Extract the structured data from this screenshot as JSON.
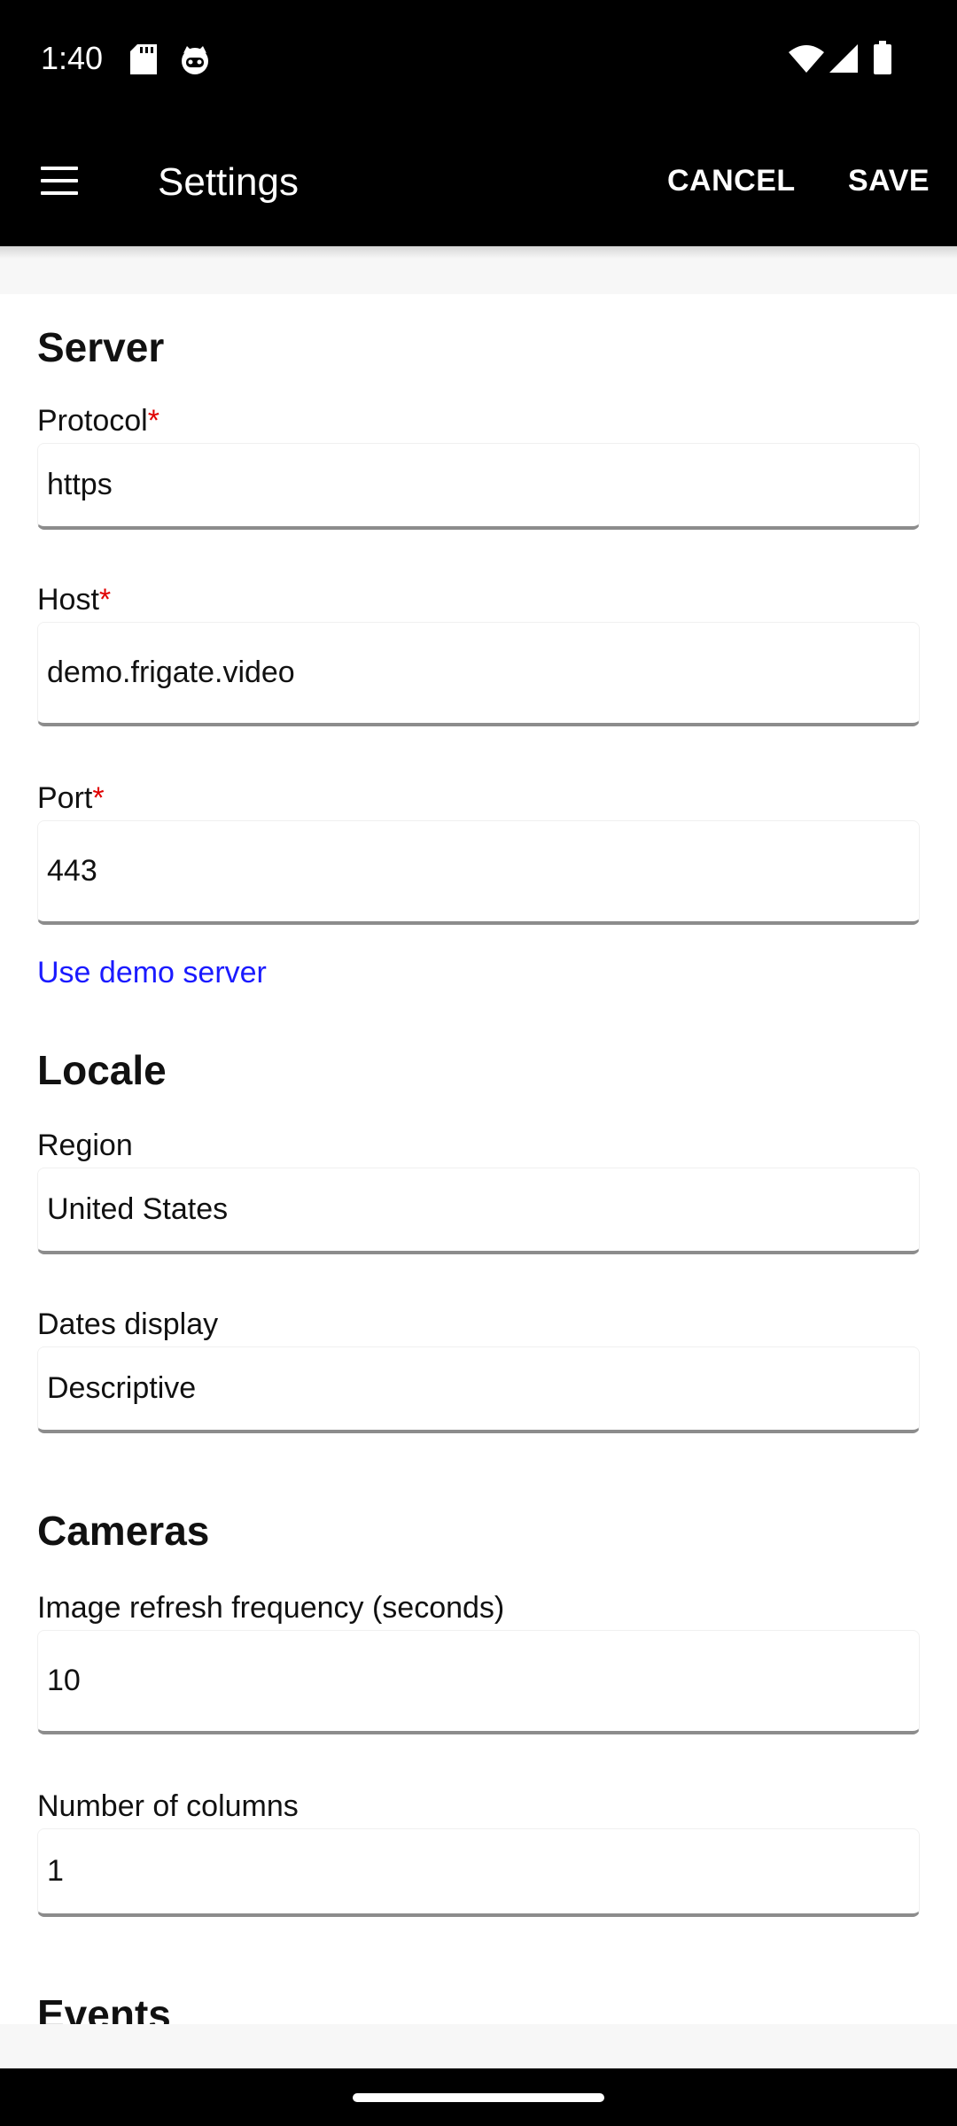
{
  "status_bar": {
    "time": "1:40",
    "icons": [
      "sd-card-icon",
      "cat-face-icon",
      "wifi-icon",
      "cell-signal-icon",
      "battery-icon"
    ]
  },
  "app_bar": {
    "menu_icon": "hamburger-menu-icon",
    "title": "Settings",
    "cancel_label": "CANCEL",
    "save_label": "SAVE"
  },
  "server": {
    "title": "Server",
    "protocol": {
      "label": "Protocol",
      "required": "*",
      "value": "https"
    },
    "host": {
      "label": "Host",
      "required": "*",
      "value": "demo.frigate.video"
    },
    "port": {
      "label": "Port",
      "required": "*",
      "value": "443"
    },
    "demo_link": "Use demo server"
  },
  "locale": {
    "title": "Locale",
    "region": {
      "label": "Region",
      "value": "United States"
    },
    "dates_display": {
      "label": "Dates display",
      "value": "Descriptive"
    }
  },
  "cameras": {
    "title": "Cameras",
    "refresh": {
      "label": "Image refresh frequency (seconds)",
      "value": "10"
    },
    "columns": {
      "label": "Number of columns",
      "value": "1"
    }
  },
  "events": {
    "title": "Events"
  },
  "colors": {
    "bar_background": "#000000",
    "required_marker": "#e00000",
    "link": "#1a1aff",
    "input_underline": "#8c8c8c"
  }
}
